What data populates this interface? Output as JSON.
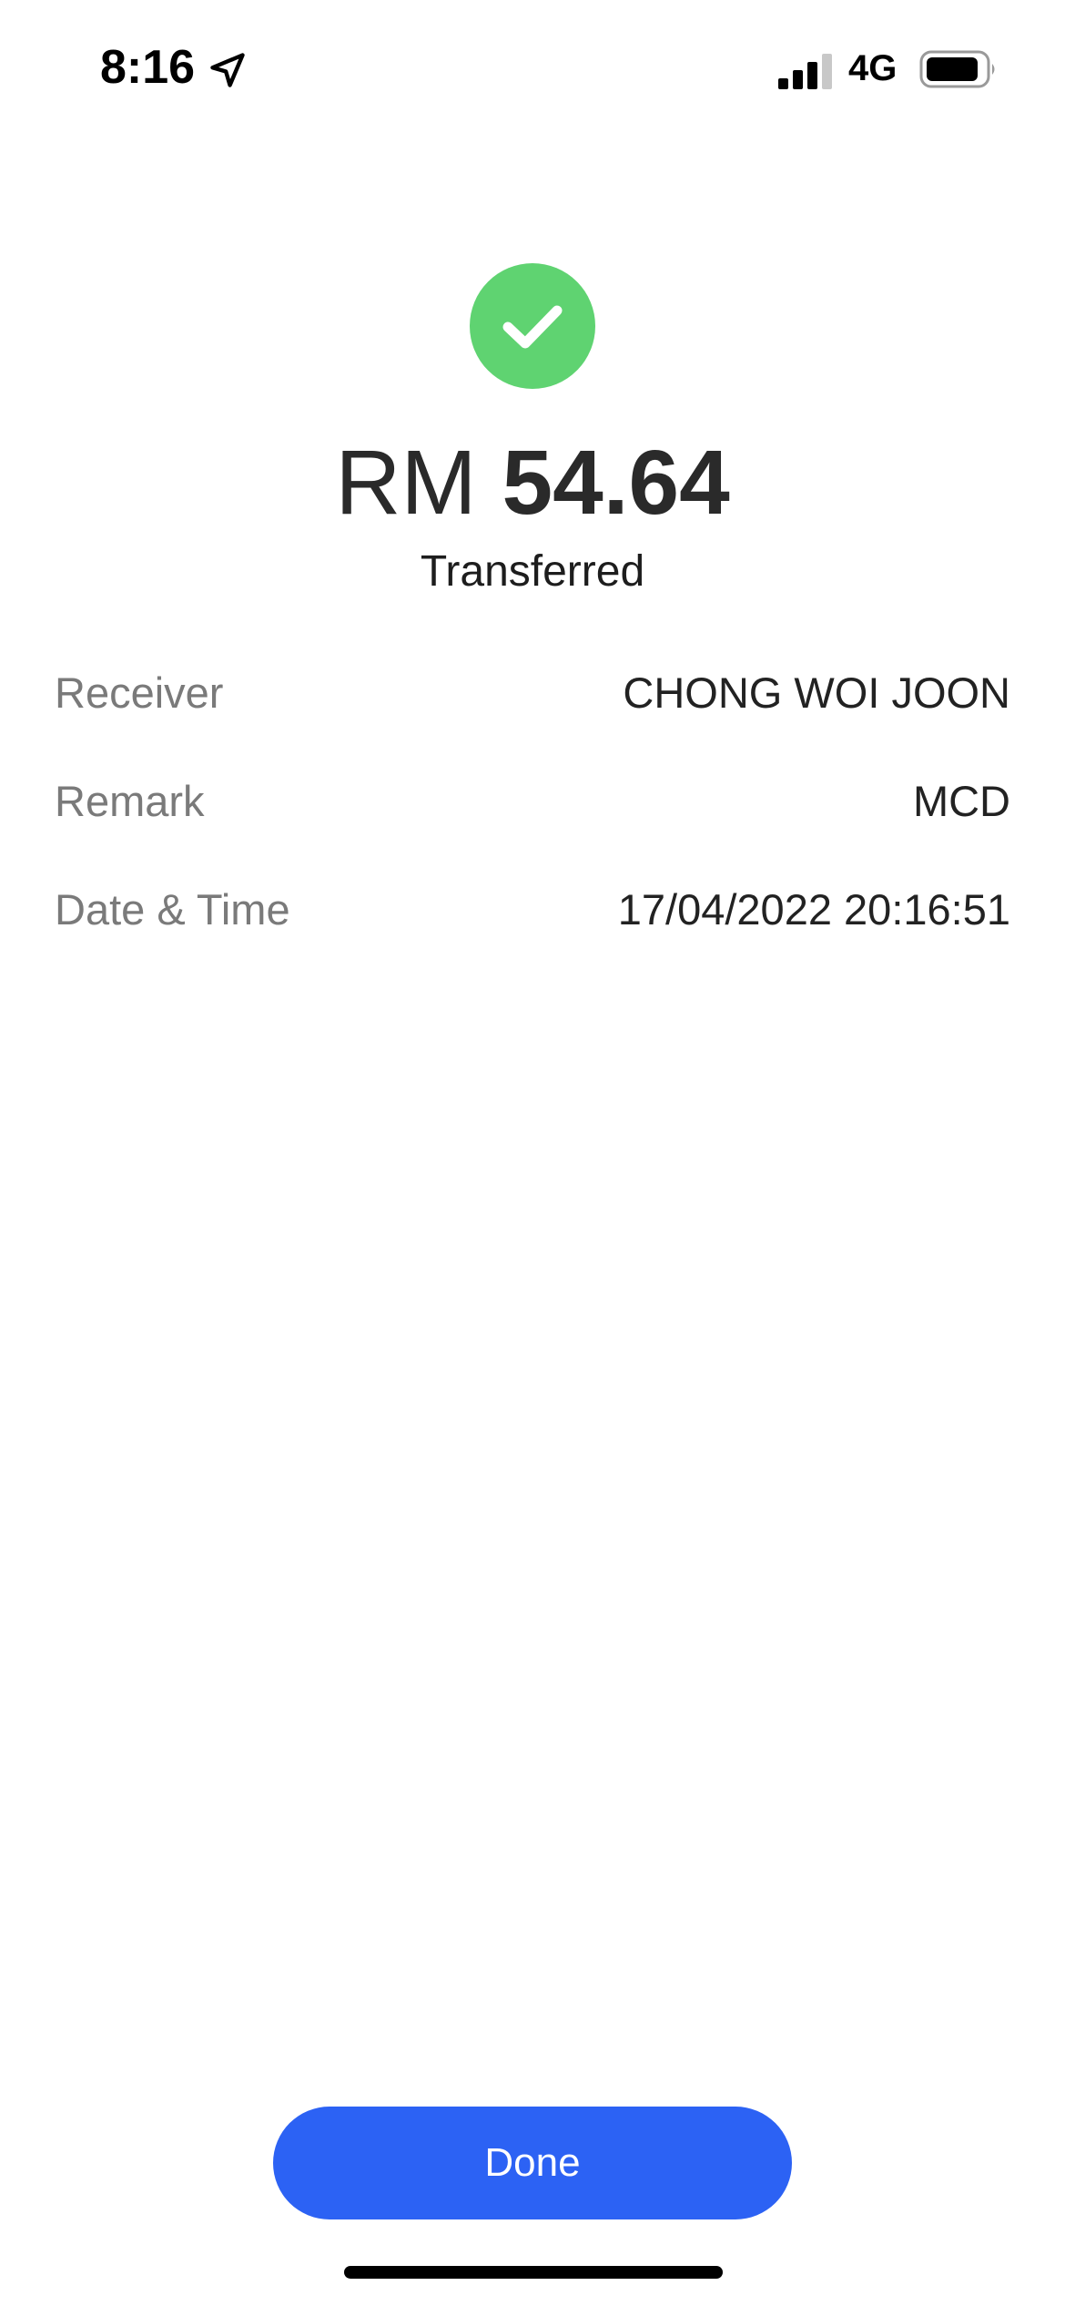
{
  "status_bar": {
    "time": "8:16",
    "network": "4G",
    "icons": [
      "location-arrow-icon",
      "signal-bars-icon",
      "battery-icon"
    ]
  },
  "result": {
    "icon": "check-circle-icon",
    "currency": "RM",
    "amount": "54.64",
    "status": "Transferred"
  },
  "details": [
    {
      "label": "Receiver",
      "value": "CHONG WOI JOON"
    },
    {
      "label": "Remark",
      "value": "MCD"
    },
    {
      "label": "Date & Time",
      "value": "17/04/2022 20:16:51"
    }
  ],
  "actions": {
    "done_label": "Done"
  },
  "colors": {
    "success": "#5fd371",
    "primary": "#2c62f4",
    "label": "#7a7a7a",
    "text": "#222222"
  }
}
